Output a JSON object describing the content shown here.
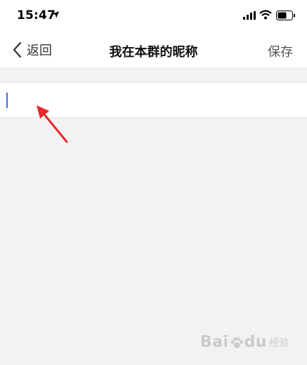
{
  "status_bar": {
    "time": "15:47",
    "icons": [
      "location-arrow-icon",
      "signal-icon",
      "wifi-icon",
      "battery-icon"
    ]
  },
  "nav": {
    "back_label": "返回",
    "title": "我在本群的昵称",
    "save_label": "保存"
  },
  "nickname_field": {
    "value": "",
    "placeholder": ""
  },
  "colors": {
    "caret": "#3b6cf2",
    "annotation_arrow": "#e32b2b",
    "background": "#f2f2f5"
  },
  "watermark": {
    "main_prefix": "Bai",
    "main_suffix": "du",
    "sub": "经验"
  }
}
